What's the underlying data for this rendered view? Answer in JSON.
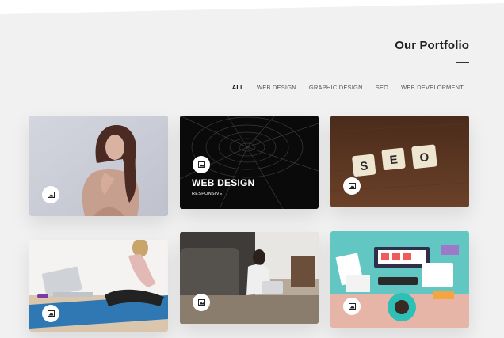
{
  "portfolio": {
    "title": "Our Portfolio",
    "filters": [
      "ALL",
      "WEB DESIGN",
      "GRAPHIC DESIGN",
      "SEO",
      "WEB DEVELOPMENT"
    ],
    "active_filter": "ALL"
  },
  "cards": [
    {
      "name": "portfolio-card-portrait",
      "icon": "image-icon"
    },
    {
      "name": "portfolio-card-web-design",
      "icon": "image-icon",
      "caption_title": "WEB DESIGN",
      "caption_sub": "RESPONSIVE"
    },
    {
      "name": "portfolio-card-seo",
      "icon": "image-icon",
      "tiles": [
        "S",
        "E",
        "O"
      ]
    },
    {
      "name": "portfolio-card-yoga-laptop",
      "icon": "image-icon"
    },
    {
      "name": "portfolio-card-sofa-laptop",
      "icon": "image-icon"
    },
    {
      "name": "portfolio-card-workspace",
      "icon": "image-icon"
    }
  ],
  "colors": {
    "background": "#f1f1f1",
    "heading": "#222222",
    "filter_active": "#111111",
    "filter": "#555555"
  }
}
